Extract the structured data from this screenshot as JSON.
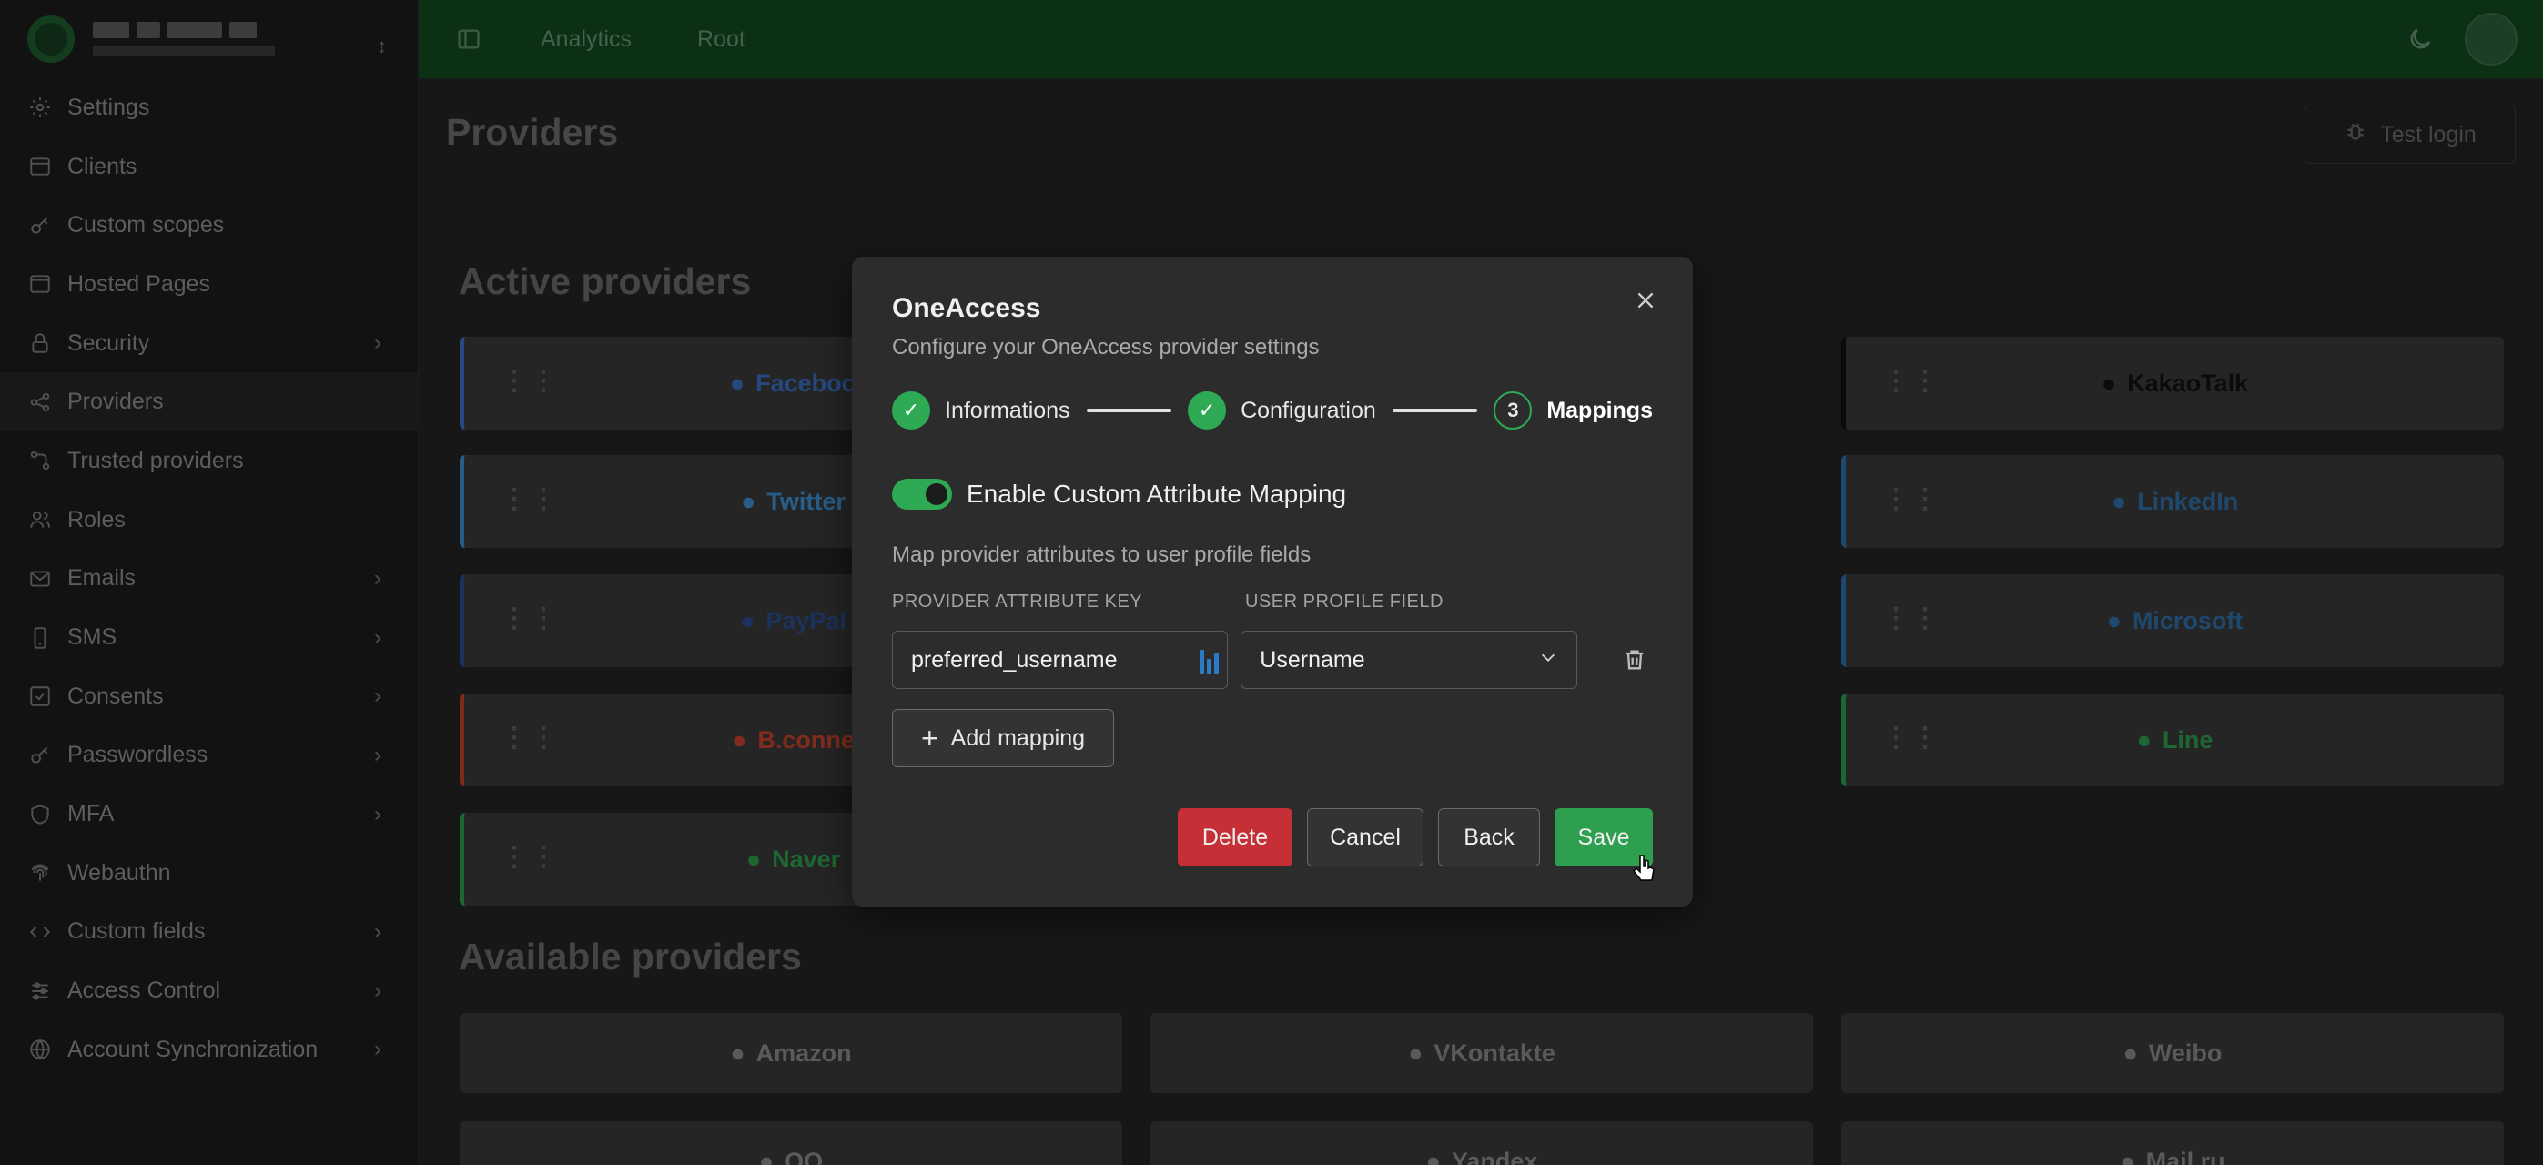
{
  "sidebar": {
    "items": [
      {
        "label": "Settings",
        "icon": "gear-icon",
        "chevron": false
      },
      {
        "label": "Clients",
        "icon": "window-icon",
        "chevron": false
      },
      {
        "label": "Custom scopes",
        "icon": "key-icon",
        "chevron": false
      },
      {
        "label": "Hosted Pages",
        "icon": "browser-icon",
        "chevron": false
      },
      {
        "label": "Security",
        "icon": "lock-icon",
        "chevron": true
      },
      {
        "label": "Providers",
        "icon": "share-icon",
        "chevron": false,
        "active": true
      },
      {
        "label": "Trusted providers",
        "icon": "nodes-icon",
        "chevron": false
      },
      {
        "label": "Roles",
        "icon": "users-icon",
        "chevron": false
      },
      {
        "label": "Emails",
        "icon": "mail-icon",
        "chevron": true
      },
      {
        "label": "SMS",
        "icon": "phone-icon",
        "chevron": true
      },
      {
        "label": "Consents",
        "icon": "checkbox-icon",
        "chevron": true
      },
      {
        "label": "Passwordless",
        "icon": "key-icon",
        "chevron": true
      },
      {
        "label": "MFA",
        "icon": "shield-icon",
        "chevron": true
      },
      {
        "label": "Webauthn",
        "icon": "fingerprint-icon",
        "chevron": false
      },
      {
        "label": "Custom fields",
        "icon": "code-icon",
        "chevron": true
      },
      {
        "label": "Access Control",
        "icon": "sliders-icon",
        "chevron": true
      },
      {
        "label": "Account Synchronization",
        "icon": "globe-icon",
        "chevron": true
      }
    ]
  },
  "topbar": {
    "links": [
      "Analytics",
      "Root"
    ]
  },
  "page": {
    "title": "Providers",
    "test_login": "Test login",
    "active_title": "Active providers",
    "available_title": "Available providers"
  },
  "active_providers": {
    "col1": [
      {
        "name": "Facebook",
        "text": "Faceboo",
        "color": "#3b6fc4"
      },
      {
        "name": "Twitter",
        "text": "Twitter",
        "color": "#3d8fd1"
      },
      {
        "name": "PayPal",
        "text": "PayPal",
        "color": "#2a4d8f"
      },
      {
        "name": "B.connect",
        "text": "B.conne",
        "color": "#c8432b"
      },
      {
        "name": "Naver",
        "text": "Naver",
        "color": "#2e9e4e"
      }
    ],
    "col3": [
      {
        "name": "KakaoTalk",
        "text": "KakaoTalk",
        "color": "#111111"
      },
      {
        "name": "LinkedIn",
        "text": "LinkedIn",
        "color": "#2f6fa8"
      },
      {
        "name": "Microsoft",
        "text": "Microsoft",
        "color": "#2f6fa8"
      },
      {
        "name": "Line",
        "text": "Line",
        "color": "#2e9e4e"
      }
    ]
  },
  "available_providers": {
    "row1": [
      "Amazon",
      "VKontakte",
      "Weibo"
    ],
    "row2": [
      "QQ",
      "Yandex",
      "Mail.ru"
    ]
  },
  "modal": {
    "title": "OneAccess",
    "subtitle": "Configure your OneAccess provider settings",
    "steps": [
      {
        "label": "Informations",
        "state": "done"
      },
      {
        "label": "Configuration",
        "state": "done"
      },
      {
        "label": "Mappings",
        "state": "current",
        "number": "3"
      }
    ],
    "toggle_label": "Enable Custom Attribute Mapping",
    "toggle_on": true,
    "mapping_description": "Map provider attributes to user profile fields",
    "col_attribute": "PROVIDER ATTRIBUTE KEY",
    "col_profile": "USER PROFILE FIELD",
    "mapping": {
      "attribute_value": "preferred_username",
      "profile_value": "Username"
    },
    "add_mapping": "Add mapping",
    "buttons": {
      "delete": "Delete",
      "cancel": "Cancel",
      "back": "Back",
      "save": "Save"
    }
  }
}
